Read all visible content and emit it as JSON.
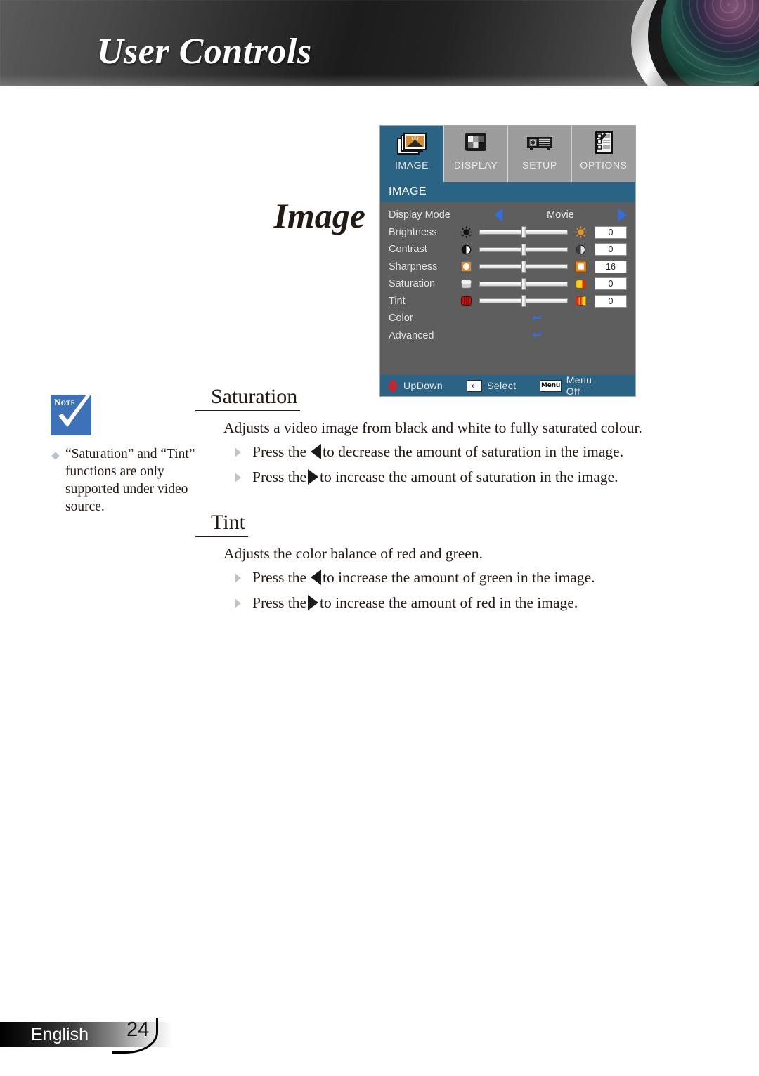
{
  "header": {
    "title": "User Controls",
    "lens_icon": "projector-lens-icon"
  },
  "section_title": "Image",
  "osd": {
    "tabs": [
      {
        "label": "IMAGE",
        "icon": "image-photos-icon",
        "active": true
      },
      {
        "label": "DISPLAY",
        "icon": "display-monitor-icon",
        "active": false
      },
      {
        "label": "SETUP",
        "icon": "projector-setup-icon",
        "active": false
      },
      {
        "label": "OPTIONS",
        "icon": "options-checklist-icon",
        "active": false
      }
    ],
    "section_bar": "IMAGE",
    "rows": [
      {
        "type": "option",
        "label": "Display Mode",
        "value": "Movie",
        "left_icon": "arrow-left-icon",
        "right_icon": "arrow-right-icon"
      },
      {
        "type": "slider",
        "label": "Brightness",
        "value": "0",
        "left_icon": "brightness-low-icon",
        "right_icon": "brightness-high-icon"
      },
      {
        "type": "slider",
        "label": "Contrast",
        "value": "0",
        "left_icon": "contrast-low-icon",
        "right_icon": "contrast-high-icon"
      },
      {
        "type": "slider",
        "label": "Sharpness",
        "value": "16",
        "left_icon": "sharpness-low-icon",
        "right_icon": "sharpness-high-icon"
      },
      {
        "type": "slider",
        "label": "Saturation",
        "value": "0",
        "left_icon": "saturation-low-icon",
        "right_icon": "saturation-high-icon"
      },
      {
        "type": "slider",
        "label": "Tint",
        "value": "0",
        "left_icon": "tint-low-icon",
        "right_icon": "tint-high-icon"
      },
      {
        "type": "submenu",
        "label": "Color",
        "glyph": "↵",
        "icon": "enter-arrow-icon"
      },
      {
        "type": "submenu",
        "label": "Advanced",
        "glyph": "↵",
        "icon": "enter-arrow-icon"
      }
    ],
    "footer": [
      {
        "label": "UpDown",
        "icon": "up-down-diamond-icon",
        "key": ""
      },
      {
        "label": "Select",
        "icon": "enter-key-icon",
        "key": "↵"
      },
      {
        "label": "Menu Off",
        "icon": "menu-key-icon",
        "key": "Menu"
      }
    ],
    "colors": {
      "accent_blue": "#2b6384",
      "arrow_blue": "#2f6fe0",
      "panel_gray": "#5e5e5e",
      "tab_gray": "#9c9c9c",
      "red": "#d81f26"
    }
  },
  "note": {
    "badge_label": "Note",
    "badge_icon": "note-check-icon",
    "bullet_icon": "diamond-bullet-icon",
    "text": "“Saturation” and “Tint” functions are only supported under video source."
  },
  "sections": [
    {
      "heading": "Saturation",
      "paragraph": "Adjusts a video image from black and white to fully saturated colour.",
      "bullets": [
        {
          "prefix": "Press the",
          "arrow": "left-triangle-icon",
          "suffix": "to decrease the amount of saturation in the image."
        },
        {
          "prefix": "Press the",
          "arrow": "right-triangle-icon",
          "suffix": "to increase the amount of saturation in the image."
        }
      ]
    },
    {
      "heading": "Tint",
      "paragraph": "Adjusts the color balance of red and green.",
      "bullets": [
        {
          "prefix": "Press the",
          "arrow": "left-triangle-icon",
          "suffix": "to increase the amount of green in the image."
        },
        {
          "prefix": "Press the",
          "arrow": "right-triangle-icon",
          "suffix": "to increase the amount of red in the image."
        }
      ]
    }
  ],
  "page_footer": {
    "language": "English",
    "page_number": "24"
  }
}
